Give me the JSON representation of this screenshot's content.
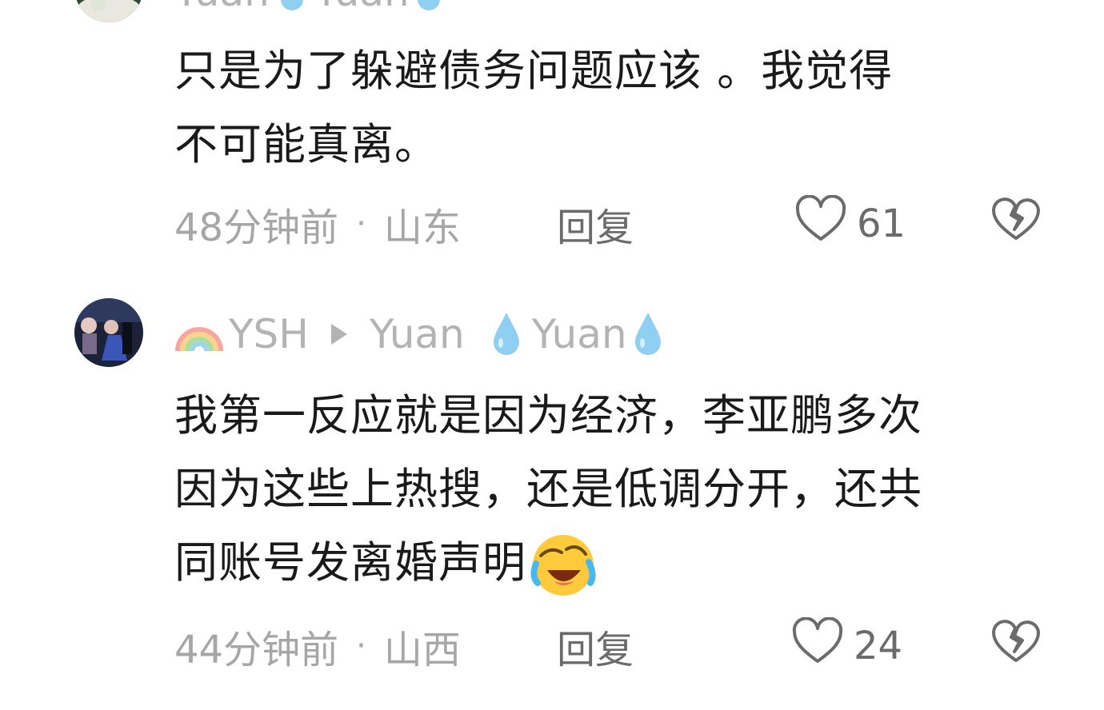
{
  "comments": [
    {
      "username_parts": [
        "Yuan",
        "Yuan"
      ],
      "text_line1": "只是为了躲避债务问题应该 。我觉得",
      "text_line2": "不可能真离。",
      "time": "48分钟前",
      "location": "山东",
      "reply_label": "回复",
      "likes": "61"
    },
    {
      "username_parts": [
        "YSH",
        "Yuan",
        "Yuan"
      ],
      "text_line1": "我第一反应就是因为经济，李亚鹏多次",
      "text_line2": "因为这些上热搜，还是低调分开，还共",
      "text_line3": "同账号发离婚声明",
      "time": "44分钟前",
      "location": "山西",
      "reply_label": "回复",
      "likes": "24"
    }
  ],
  "icons": {
    "like": "heart-outline-icon",
    "dislike": "broken-heart-icon",
    "rainbow": "rainbow-emoji-icon",
    "play": "play-arrow-icon",
    "droplet": "droplet-emoji-icon",
    "laugh_cry": "rolling-laughing-emoji-icon"
  },
  "colors": {
    "text_primary": "#1a1a1a",
    "text_secondary": "#a6a6a6",
    "action_text": "#6b6b6b",
    "username": "#b3b3b3",
    "droplet": "#8fd0f2"
  }
}
